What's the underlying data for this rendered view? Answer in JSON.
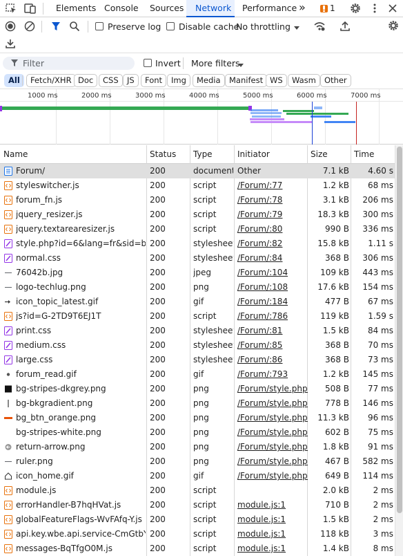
{
  "tabs": {
    "items": [
      "Elements",
      "Console",
      "Sources",
      "Network",
      "Performance"
    ],
    "overflow": "»",
    "issues_count": "1"
  },
  "toolbar": {
    "preserve_log": "Preserve log",
    "disable_cache": "Disable cache",
    "throttling": "No throttling"
  },
  "filter": {
    "placeholder": "Filter",
    "invert": "Invert",
    "more_filters": "More filters"
  },
  "type_chips": [
    "All",
    "Fetch/XHR",
    "Doc",
    "CSS",
    "JS",
    "Font",
    "Img",
    "Media",
    "Manifest",
    "WS",
    "Wasm",
    "Other"
  ],
  "timeline": {
    "ticks": [
      "1000 ms",
      "2000 ms",
      "3000 ms",
      "4000 ms",
      "5000 ms",
      "6000 ms",
      "7000 ms"
    ]
  },
  "table": {
    "headers": [
      "Name",
      "Status",
      "Type",
      "Initiator",
      "Size",
      "Time"
    ],
    "rows": [
      {
        "icon": "document-icon",
        "name": "Forum/",
        "status": "200",
        "type": "document",
        "initiator": "Other",
        "size": "7.1 kB",
        "time": "4.60 s"
      },
      {
        "icon": "script-icon",
        "name": "styleswitcher.js",
        "status": "200",
        "type": "script",
        "initiator": "/Forum/:77",
        "size": "1.2 kB",
        "time": "68 ms"
      },
      {
        "icon": "script-icon",
        "name": "forum_fn.js",
        "status": "200",
        "type": "script",
        "initiator": "/Forum/:78",
        "size": "3.1 kB",
        "time": "206 ms"
      },
      {
        "icon": "script-icon",
        "name": "jquery_resizer.js",
        "status": "200",
        "type": "script",
        "initiator": "/Forum/:79",
        "size": "18.3 kB",
        "time": "300 ms"
      },
      {
        "icon": "script-icon",
        "name": "jquery.textarearesizer.js",
        "status": "200",
        "type": "script",
        "initiator": "/Forum/:80",
        "size": "990 B",
        "time": "336 ms"
      },
      {
        "icon": "stylesheet-icon",
        "name": "style.php?id=6&lang=fr&sid=b0...",
        "status": "200",
        "type": "stylesheet",
        "initiator": "/Forum/:82",
        "size": "15.8 kB",
        "time": "1.11 s"
      },
      {
        "icon": "stylesheet-icon",
        "name": "normal.css",
        "status": "200",
        "type": "stylesheet",
        "initiator": "/Forum/:84",
        "size": "368 B",
        "time": "306 ms"
      },
      {
        "icon": "image-dash-icon",
        "name": "76042b.jpg",
        "status": "200",
        "type": "jpeg",
        "initiator": "/Forum/:104",
        "size": "109 kB",
        "time": "443 ms"
      },
      {
        "icon": "image-dash-icon",
        "name": "logo-techlug.png",
        "status": "200",
        "type": "png",
        "initiator": "/Forum/:108",
        "size": "17.6 kB",
        "time": "154 ms"
      },
      {
        "icon": "image-arrow-icon",
        "name": "icon_topic_latest.gif",
        "status": "200",
        "type": "gif",
        "initiator": "/Forum/:184",
        "size": "477 B",
        "time": "67 ms"
      },
      {
        "icon": "script-icon",
        "name": "js?id=G-2TD9T6EJ1T",
        "status": "200",
        "type": "script",
        "initiator": "/Forum/:786",
        "size": "119 kB",
        "time": "1.59 s"
      },
      {
        "icon": "stylesheet-icon",
        "name": "print.css",
        "status": "200",
        "type": "stylesheet",
        "initiator": "/Forum/:81",
        "size": "1.5 kB",
        "time": "84 ms"
      },
      {
        "icon": "stylesheet-icon",
        "name": "medium.css",
        "status": "200",
        "type": "stylesheet",
        "initiator": "/Forum/:85",
        "size": "368 B",
        "time": "70 ms"
      },
      {
        "icon": "stylesheet-icon",
        "name": "large.css",
        "status": "200",
        "type": "stylesheet",
        "initiator": "/Forum/:86",
        "size": "368 B",
        "time": "73 ms"
      },
      {
        "icon": "image-dot-icon",
        "name": "forum_read.gif",
        "status": "200",
        "type": "gif",
        "initiator": "/Forum/:793",
        "size": "1.2 kB",
        "time": "145 ms"
      },
      {
        "icon": "image-black-icon",
        "name": "bg-stripes-dkgrey.png",
        "status": "200",
        "type": "png",
        "initiator": "/Forum/style.php?id",
        "size": "508 B",
        "time": "77 ms"
      },
      {
        "icon": "image-bar-icon",
        "name": "bg-bkgradient.png",
        "status": "200",
        "type": "png",
        "initiator": "/Forum/style.php?id",
        "size": "778 B",
        "time": "146 ms"
      },
      {
        "icon": "image-orange-icon",
        "name": "bg_btn_orange.png",
        "status": "200",
        "type": "png",
        "initiator": "/Forum/style.php?id",
        "size": "11.3 kB",
        "time": "96 ms"
      },
      {
        "icon": "image-blank-icon",
        "name": "bg-stripes-white.png",
        "status": "200",
        "type": "png",
        "initiator": "/Forum/style.php?id",
        "size": "602 B",
        "time": "75 ms"
      },
      {
        "icon": "image-circle-icon",
        "name": "return-arrow.png",
        "status": "200",
        "type": "png",
        "initiator": "/Forum/style.php?id",
        "size": "1.8 kB",
        "time": "91 ms"
      },
      {
        "icon": "image-dash-icon",
        "name": "ruler.png",
        "status": "200",
        "type": "png",
        "initiator": "/Forum/style.php?id",
        "size": "467 B",
        "time": "582 ms"
      },
      {
        "icon": "home-icon",
        "name": "icon_home.gif",
        "status": "200",
        "type": "gif",
        "initiator": "/Forum/style.php?id",
        "size": "649 B",
        "time": "114 ms"
      },
      {
        "icon": "script-icon",
        "name": "module.js",
        "status": "200",
        "type": "script",
        "initiator": "",
        "size": "2.0 kB",
        "time": "2 ms"
      },
      {
        "icon": "script-icon",
        "name": "errorHandler-B7hqHVat.js",
        "status": "200",
        "type": "script",
        "initiator": "module.js:1",
        "size": "710 B",
        "time": "2 ms"
      },
      {
        "icon": "script-icon",
        "name": "globalFeatureFlags-WvFAfq-Y.js",
        "status": "200",
        "type": "script",
        "initiator": "module.js:1",
        "size": "1.5 kB",
        "time": "2 ms"
      },
      {
        "icon": "script-icon",
        "name": "api.key.wbe.api.service-CmGtbYi...",
        "status": "200",
        "type": "script",
        "initiator": "module.js:1",
        "size": "118 kB",
        "time": "3 ms"
      },
      {
        "icon": "script-icon",
        "name": "messages-BqTfgO0M.js",
        "status": "200",
        "type": "script",
        "initiator": "module.js:1",
        "size": "1.4 kB",
        "time": "8 ms"
      }
    ]
  },
  "colors": {
    "accent": "#0b57d0",
    "script": "#e8710a",
    "stylesheet": "#9334e6",
    "document": "#1a73e8"
  }
}
